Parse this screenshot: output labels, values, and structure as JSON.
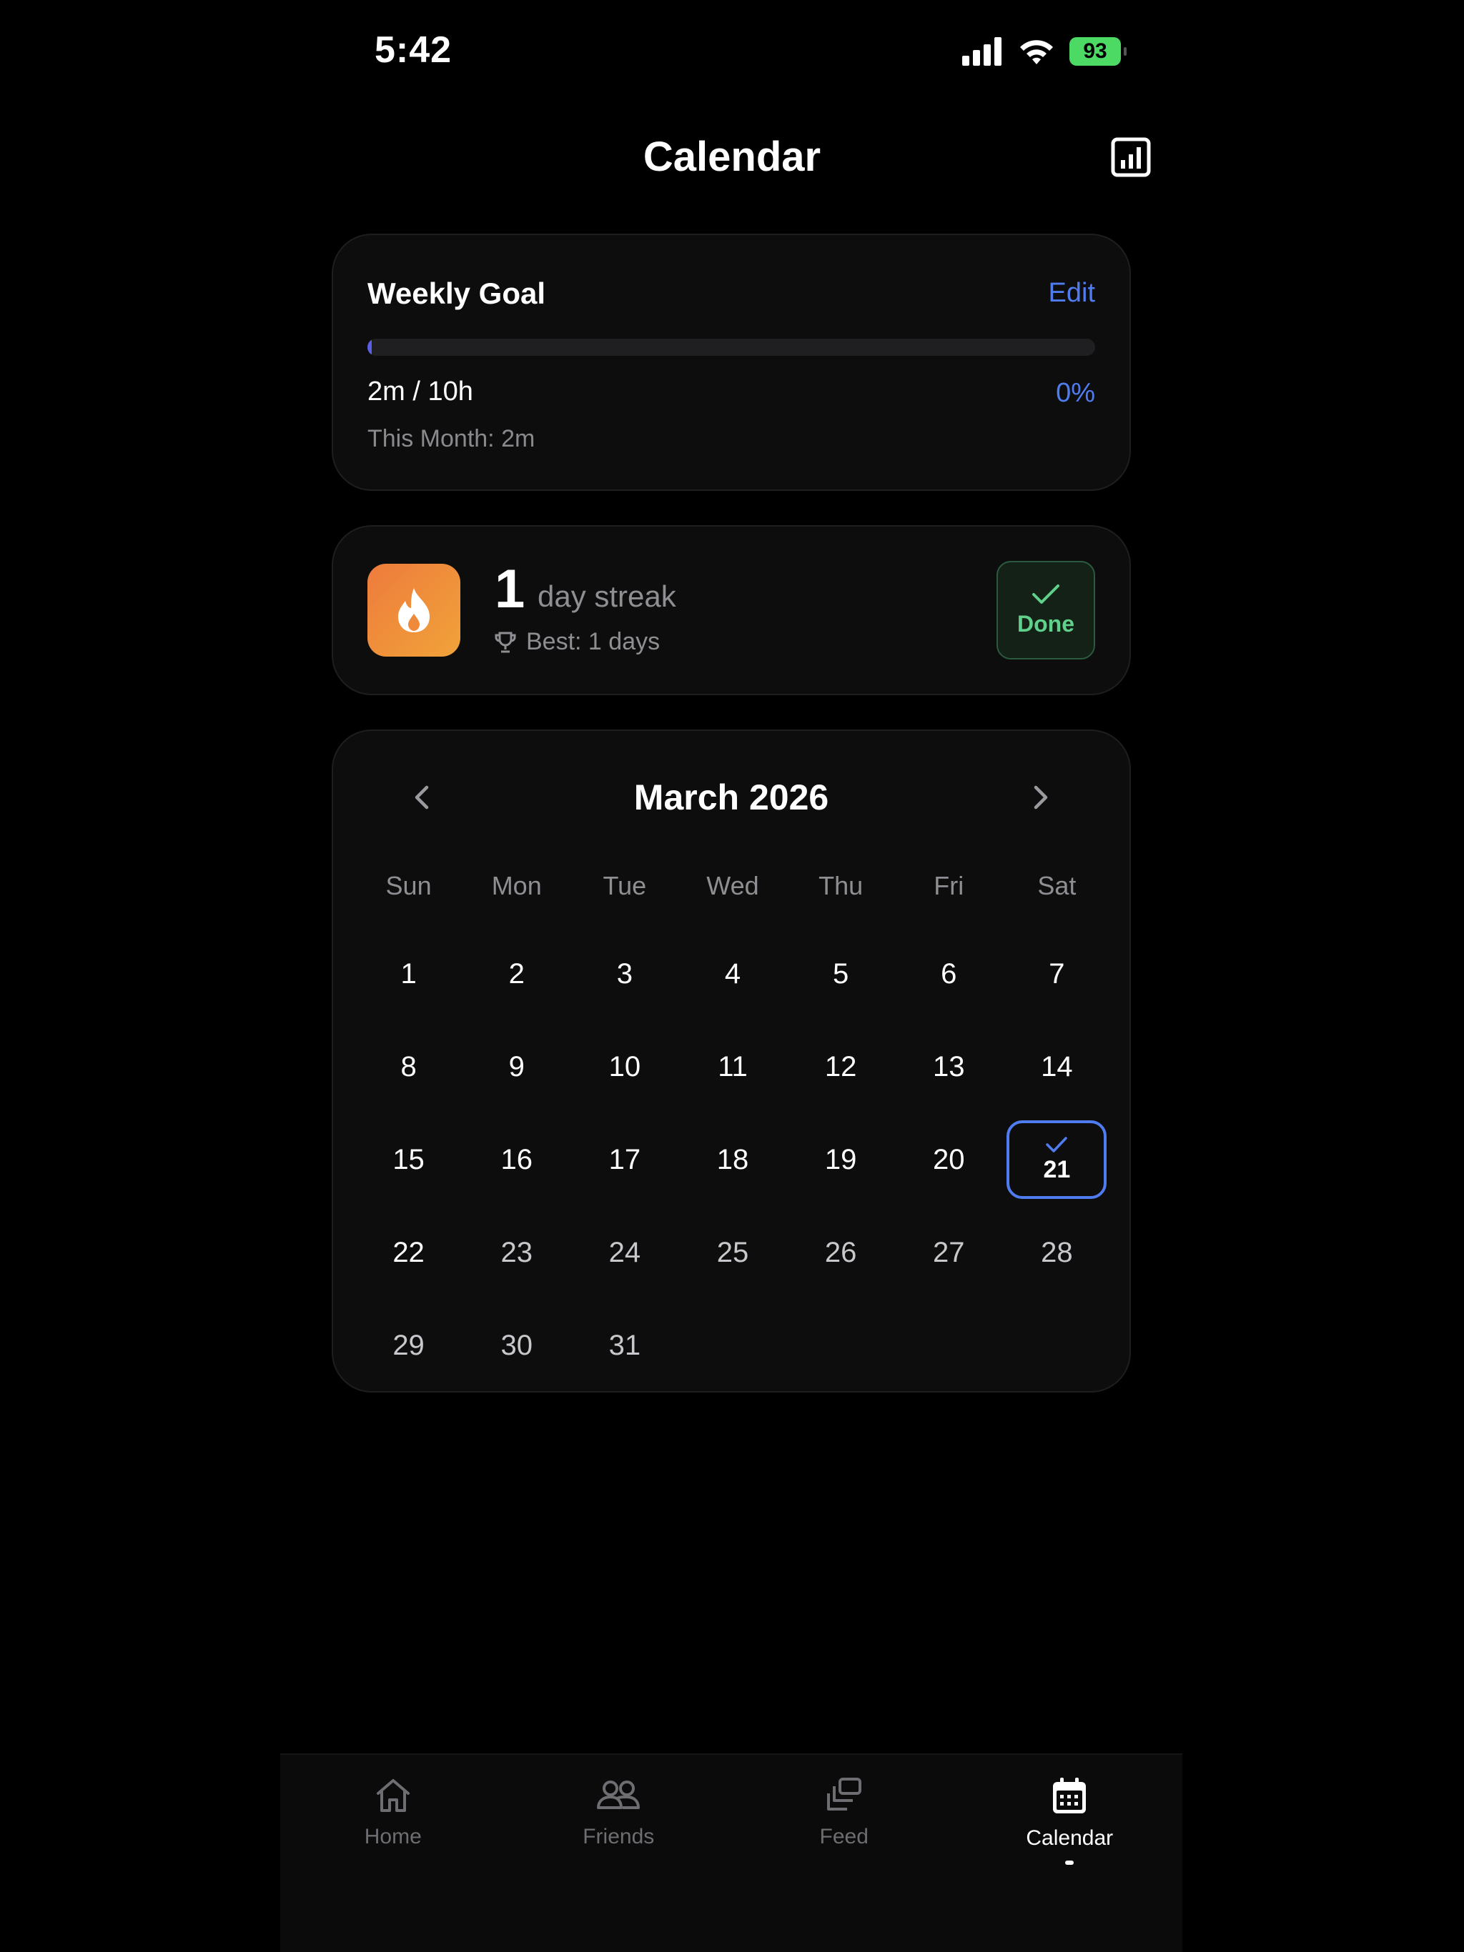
{
  "status_bar": {
    "time": "5:42",
    "battery": "93",
    "icons": [
      "signal-icon",
      "wifi-icon",
      "battery-icon"
    ]
  },
  "header": {
    "title": "Calendar",
    "stats_icon": "bar-chart-icon"
  },
  "weekly_goal": {
    "title": "Weekly Goal",
    "edit_label": "Edit",
    "progress_text": "2m / 10h",
    "percent_label": "0%",
    "progress_fraction": 0.003,
    "month_text": "This Month: 2m"
  },
  "streak": {
    "count": "1",
    "label": "day streak",
    "best_text": "Best: 1 days",
    "done_label": "Done",
    "icon": "flame-icon"
  },
  "calendar": {
    "month_title": "March 2026",
    "weekdays": [
      "Sun",
      "Mon",
      "Tue",
      "Wed",
      "Thu",
      "Fri",
      "Sat"
    ],
    "weeks": [
      [
        "1",
        "2",
        "3",
        "4",
        "5",
        "6",
        "7"
      ],
      [
        "8",
        "9",
        "10",
        "11",
        "12",
        "13",
        "14"
      ],
      [
        "15",
        "16",
        "17",
        "18",
        "19",
        "20",
        "21"
      ],
      [
        "22",
        "23",
        "24",
        "25",
        "26",
        "27",
        "28"
      ],
      [
        "29",
        "30",
        "31",
        "",
        "",
        "",
        ""
      ]
    ],
    "today": "21"
  },
  "tabs": [
    {
      "label": "Home",
      "icon": "home-icon"
    },
    {
      "label": "Friends",
      "icon": "friends-icon"
    },
    {
      "label": "Feed",
      "icon": "feed-icon"
    },
    {
      "label": "Calendar",
      "icon": "calendar-icon"
    }
  ],
  "colors": {
    "accent": "#4f7df0",
    "done_green": "#5fd18a",
    "flame_start": "#ee7b3c",
    "flame_end": "#f0a33a"
  }
}
